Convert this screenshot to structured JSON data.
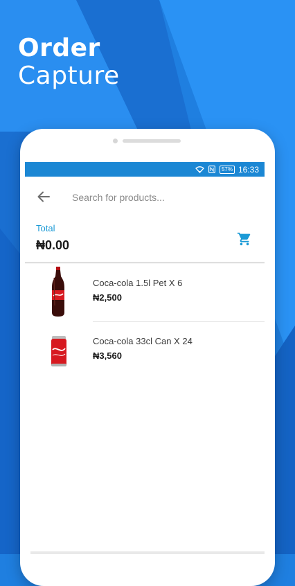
{
  "hero": {
    "line1": "Order",
    "line2": "Capture"
  },
  "colors": {
    "accent": "#1b87d4",
    "background": "#1f7fe0",
    "label": "#1b9ad6"
  },
  "status_bar": {
    "time": "16:33",
    "battery": "57%",
    "icons": [
      "wifi-icon",
      "nfc-icon",
      "battery-icon"
    ]
  },
  "search": {
    "placeholder": "Search for products..."
  },
  "total": {
    "label": "Total",
    "value": "₦0.00"
  },
  "products": [
    {
      "name": "Coca-cola 1.5l Pet X 6",
      "price": "₦2,500",
      "icon": "coca-cola-bottle-image"
    },
    {
      "name": "Coca-cola 33cl Can X 24",
      "price": "₦3,560",
      "icon": "coca-cola-can-image"
    }
  ]
}
